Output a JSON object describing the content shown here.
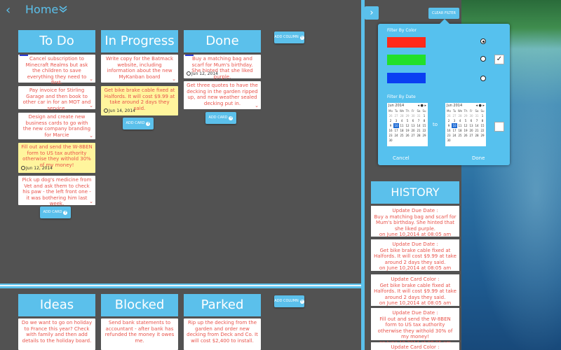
{
  "header": {
    "title": "Home"
  },
  "buttons": {
    "add_column": "ADD COLUMN",
    "add_card": "ADD CARD"
  },
  "columns": {
    "todo": {
      "title": "To Do",
      "cards": [
        "Cancel subscription to Minecraft Realms but ask the children to save everything they need to first.",
        "Pay invoice for Stirling Garage and then book to other car in for an MOT and service.",
        "Design and create new business cards to go with the new company branding for Marcie",
        "Fill out and send the W-8BEN form to US tax authority otherwise they withold 30% of my money!",
        "Pick up dog's medicine from Vet and ask them to check his paw - the left front one - it was bothering him last week."
      ],
      "date4": "Jun 12, 2014"
    },
    "progress": {
      "title": "In Progress",
      "cards": [
        "Write copy for the Batmack website, including information about the new MyKanban board",
        "Get bike brake cable fixed at Halfords. It will cost $9.99 at take around 2 days they said."
      ],
      "date2": "Jun 14, 2014"
    },
    "done": {
      "title": "Done",
      "cards": [
        "Buy a matching bag and scarf for Mum's birthday. She hinted that she liked purple.",
        "Get three quotes to have the decking in the garden ripped up, and new weather sealed decking put in."
      ],
      "date1": "Jun 12, 2014"
    },
    "ideas": {
      "title": "Ideas",
      "cards": [
        "Do we want to go on holiday to France this year? Check with family and then add details to the holiday board."
      ]
    },
    "blocked": {
      "title": "Blocked",
      "cards": [
        "Send bank statements to accountant - after bank has refunded the money it owes me."
      ]
    },
    "parked": {
      "title": "Parked",
      "cards": [
        "Rip up the decking from the garden and order new decking from Deck and Co. It will cost $2,400 to install."
      ]
    }
  },
  "right_panel": {
    "clear_filter": "CLEAR FILTER"
  },
  "filter": {
    "by_color_label": "Filter By Color",
    "colors": [
      "#ff2a1a",
      "#22e02a",
      "#0a3ff2"
    ],
    "by_date_label": "Filter By Date",
    "to_label": "to",
    "cancel": "Cancel",
    "done": "Done",
    "calendar": {
      "month": "Jun 2014",
      "nav": "◂ ● ▸",
      "days": [
        "Mo",
        "Tu",
        "We",
        "Th",
        "Fr",
        "Sa",
        "Su"
      ],
      "cells": [
        "26",
        "27",
        "28",
        "29",
        "30",
        "31",
        "1",
        "2",
        "3",
        "4",
        "5",
        "6",
        "7",
        "8",
        "9",
        "10",
        "11",
        "12",
        "13",
        "14",
        "15",
        "16",
        "17",
        "18",
        "19",
        "20",
        "21",
        "22",
        "23",
        "24",
        "25",
        "26",
        "27",
        "28",
        "29",
        "30"
      ],
      "today": "10"
    }
  },
  "history": {
    "title": "HISTORY",
    "items": [
      {
        "label": "Update Due Date :",
        "text": "Buy a matching bag and scarf for Mum's birthday. She hinted that she liked purple.",
        "when": "on June 10,2014 at 08:05 am"
      },
      {
        "label": "Update Due Date :",
        "text": "Get bike brake cable fixed at Halfords. It will cost $9.99 at take around 2 days they said.",
        "when": "on June 10,2014 at 08:05 am"
      },
      {
        "label": "Update Card Color :",
        "text": "Get bike brake cable fixed at Halfords. It will cost $9.99 at take around 2 days they said.",
        "when": "on June 10,2014 at 08:05 am"
      },
      {
        "label": "Update Due Date :",
        "text": "Fill out and send the W-8BEN form to US tax authority otherwise they withold 30% of my money!",
        "when": "on June 10,2014 at 08:05 am"
      },
      {
        "label": "Update Card Color :",
        "text": "",
        "when": ""
      }
    ]
  }
}
